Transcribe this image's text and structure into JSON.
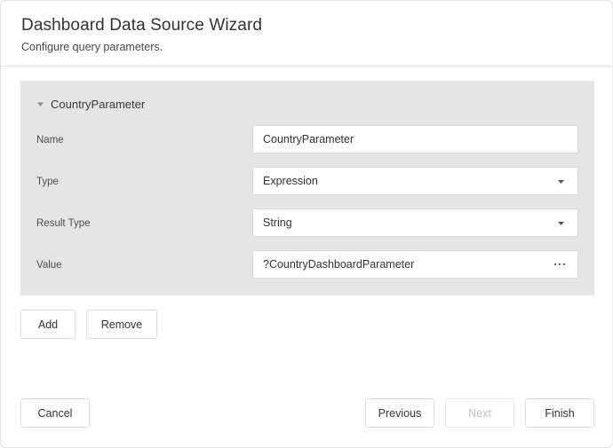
{
  "header": {
    "title": "Dashboard Data Source Wizard",
    "subtitle": "Configure query parameters."
  },
  "panel": {
    "title": "CountryParameter",
    "collapse_icon": "triangle-down-icon",
    "rows": [
      {
        "label": "Name",
        "value": "CountryParameter",
        "control": "textbox"
      },
      {
        "label": "Type",
        "value": "Expression",
        "control": "dropdown",
        "icon": "chevron-down-icon"
      },
      {
        "label": "Result Type",
        "value": "String",
        "control": "dropdown",
        "icon": "chevron-down-icon"
      },
      {
        "label": "Value",
        "value": "?CountryDashboardParameter",
        "control": "textbox-with-browse",
        "icon": "ellipsis-icon"
      }
    ]
  },
  "param_actions": {
    "add_label": "Add",
    "remove_label": "Remove"
  },
  "footer": {
    "cancel_label": "Cancel",
    "previous_label": "Previous",
    "next_label": "Next",
    "next_disabled": true,
    "finish_label": "Finish"
  },
  "colors": {
    "panel_background": "#e5e5e5",
    "page_background": "#ffffff",
    "border": "#e3e3e3",
    "text": "#333333",
    "disabled_text": "#c2c2c2"
  }
}
